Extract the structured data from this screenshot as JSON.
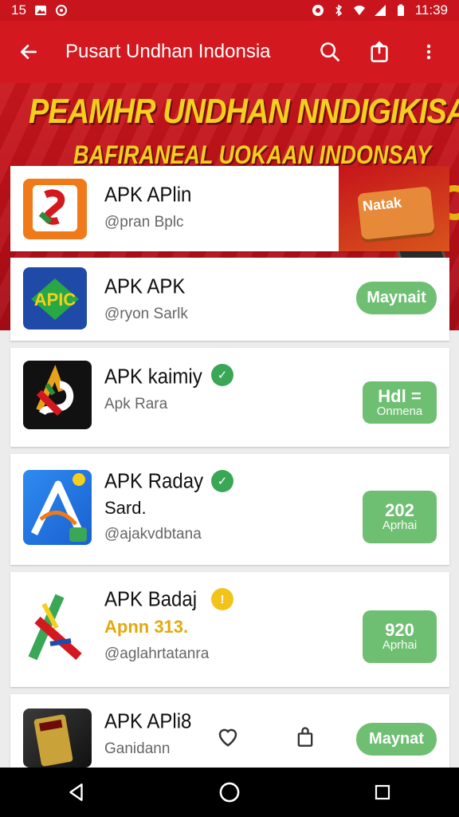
{
  "status_bar": {
    "time_left": "15",
    "time_right": "11:39"
  },
  "app_bar": {
    "title": "Pusart Undhan Indonsia"
  },
  "banner": {
    "headline": "PEAMHR UNDHAN NNDIGIKISA",
    "subheadline": "BAFIRANEAL UOKAAN INDONSAY"
  },
  "apps": [
    {
      "name": "APK APlin",
      "sub": "@pran Bplc",
      "icon_text": "",
      "promo_label": "Natak"
    },
    {
      "name": "APK APK",
      "sub": "@ryon Sarlk",
      "icon_text": "APIC",
      "button": "Maynait"
    },
    {
      "name": "APK kaimiy",
      "sub": "Apk Rara",
      "button_top": "Hdl =",
      "button_bottom": "Onmena"
    },
    {
      "name": "APK Raday",
      "extra": "Sard.",
      "sub": "@ajakvdbtana",
      "button_top": "202",
      "button_bottom": "Aprhai"
    },
    {
      "name": "APK Badaj",
      "extra": "Apnn 313.",
      "sub": "@aglahrtatanra",
      "button_top": "920",
      "button_bottom": "Aprhai"
    },
    {
      "name": "APK APli8",
      "sub": "Ganidann",
      "button": "Maynat"
    }
  ],
  "colors": {
    "brand_red": "#d3191f",
    "accent_green": "#6fbf73",
    "gold": "#f6cf1e"
  }
}
